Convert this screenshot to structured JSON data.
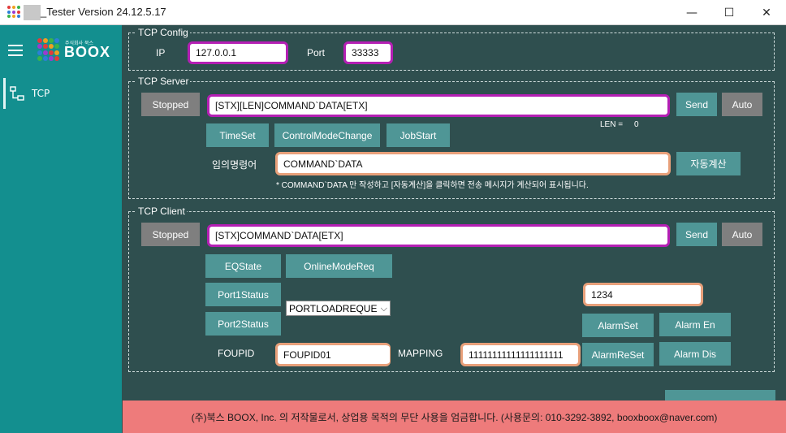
{
  "window": {
    "title": "_Tester Version 24.12.5.17",
    "controls": {
      "minimize": "—",
      "maximize": "☐",
      "close": "✕"
    }
  },
  "sidebar": {
    "logo_text": "BOOX",
    "logo_sub": "주식회사 북스",
    "items": [
      {
        "label": "TCP",
        "icon": "network-icon"
      }
    ]
  },
  "tcp_config": {
    "title": "TCP Config",
    "ip_label": "IP",
    "ip_value": "127.0.0.1",
    "port_label": "Port",
    "port_value": "33333"
  },
  "tcp_server": {
    "title": "TCP Server",
    "status_button": "Stopped",
    "message": "[STX][LEN]COMMAND`DATA[ETX]",
    "send_button": "Send",
    "auto_button": "Auto",
    "len_label": "LEN =",
    "len_value": "0",
    "buttons": [
      "TimeSet",
      "ControlModeChange",
      "JobStart"
    ],
    "arbitrary_label": "임의명령어",
    "arbitrary_value": "COMMAND`DATA",
    "auto_calc_button": "자동계산",
    "hint": "* COMMAND`DATA 만 작성하고 [자동계산]을 클릭하면 전송 메시지가 계산되어 표시됩니다."
  },
  "tcp_client": {
    "title": "TCP Client",
    "status_button": "Stopped",
    "message": "[STX]COMMAND`DATA[ETX]",
    "send_button": "Send",
    "auto_button": "Auto",
    "eqstate_button": "EQState",
    "online_button": "OnlineModeReq",
    "port1_button": "Port1Status",
    "port2_button": "Port2Status",
    "port_select": "PORTLOADREQUE",
    "alarm_input": "1234",
    "alarmset_button": "AlarmSet",
    "alarmen_button": "Alarm En",
    "alarmreset_button": "AlarmReSet",
    "alarmdis_button": "Alarm Dis",
    "foupid_label": "FOUPID",
    "foupid_value": "FOUPID01",
    "mapping_label": "MAPPING",
    "mapping_value": "11111111111111111111"
  },
  "footer": {
    "text": "(주)북스 BOOX, Inc. 의 저작물로서, 상업용 목적의 무단 사용을 엄금합니다. (사용문의: 010-3292-3892, booxboox@naver.com)"
  },
  "colors": {
    "background": "#2f4f4f",
    "sidebar": "#138f8f",
    "button": "#4f9696",
    "button_gray": "#7f7f7f",
    "input_border_purple": "#b41fb4",
    "input_border_orange": "#e8a07a",
    "footer": "#ee7b7b"
  }
}
